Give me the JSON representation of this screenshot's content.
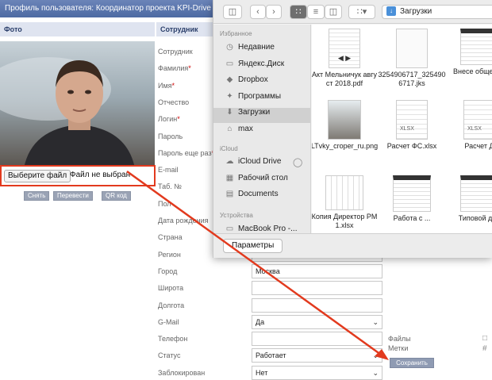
{
  "window_title": "Профиль пользователя: Координатор проекта KPI-Drive (Мельн",
  "col_photo": "Фото",
  "col_staff": "Сотрудник",
  "choose_file": "Выберите файл",
  "no_file": "Файл не выбран",
  "photo_buttons": [
    "Снять",
    "Перевести",
    "QR код"
  ],
  "fields": [
    {
      "label": "Сотрудник",
      "req": false,
      "value": ""
    },
    {
      "label": "Фамилия",
      "req": true,
      "value": ""
    },
    {
      "label": "Имя",
      "req": true,
      "value": ""
    },
    {
      "label": "Отчество",
      "req": false,
      "value": ""
    },
    {
      "label": "Логин",
      "req": true,
      "value": ""
    },
    {
      "label": "Пароль",
      "req": false,
      "value": ""
    },
    {
      "label": "Пароль еще раз",
      "req": true,
      "value": ""
    },
    {
      "label": "E-mail",
      "req": false,
      "value": ""
    },
    {
      "label": "Таб. №",
      "req": false,
      "value": ""
    },
    {
      "label": "Пол",
      "req": false,
      "value": ""
    },
    {
      "label": "Дата рождения",
      "req": false,
      "value": ""
    },
    {
      "label": "Страна",
      "req": false,
      "value": ""
    },
    {
      "label": "Регион",
      "req": false,
      "value": ""
    },
    {
      "label": "Город",
      "req": false,
      "value": "Москва"
    },
    {
      "label": "Широта",
      "req": false,
      "value": ""
    },
    {
      "label": "Долгота",
      "req": false,
      "value": ""
    },
    {
      "label": "G-Mail",
      "req": false,
      "value": "Да",
      "select": true
    },
    {
      "label": "Телефон",
      "req": false,
      "value": ""
    },
    {
      "label": "Статус",
      "req": false,
      "value": "Работает",
      "select": true
    },
    {
      "label": "Заблокирован",
      "req": false,
      "value": "Нет",
      "select": true
    }
  ],
  "side_labels": {
    "files": "Файлы",
    "tags": "Метки"
  },
  "save": "Сохранить",
  "finder": {
    "path": "Загрузки",
    "favorites_header": "Избранное",
    "favorites": [
      "Недавние",
      "Яндекс.Диск",
      "Dropbox",
      "Программы",
      "Загрузки",
      "max"
    ],
    "icloud_header": "iCloud",
    "icloud": [
      "iCloud Drive",
      "Рабочий стол",
      "Documents"
    ],
    "devices_header": "Устройства",
    "devices": [
      "MacBook Pro -..."
    ],
    "files": [
      {
        "name": "Акт Мельничук август 2018.pdf",
        "icon": "pdf-thumb"
      },
      {
        "name": "3254906717_3254906717.jks",
        "icon": "blank-doc"
      },
      {
        "name": "Внесе общего...",
        "icon": "doc-thumb"
      },
      {
        "name": "LTvky_croper_ru.png",
        "icon": "photo-thumb"
      },
      {
        "name": "Расчет ФС.xlsx",
        "icon": "xlsx-icon"
      },
      {
        "name": "Расчет Д",
        "icon": "xlsx-icon"
      },
      {
        "name": "Копия Директор PM1.xlsx",
        "icon": "sheet-thumb"
      },
      {
        "name": "Работа с ...",
        "icon": "doc-thumb"
      },
      {
        "name": "Типовой д ...",
        "icon": "doc-thumb"
      }
    ],
    "params_button": "Параметры"
  },
  "colors": {
    "header": "#4d6aa3",
    "annotation": "#e23a1e"
  }
}
